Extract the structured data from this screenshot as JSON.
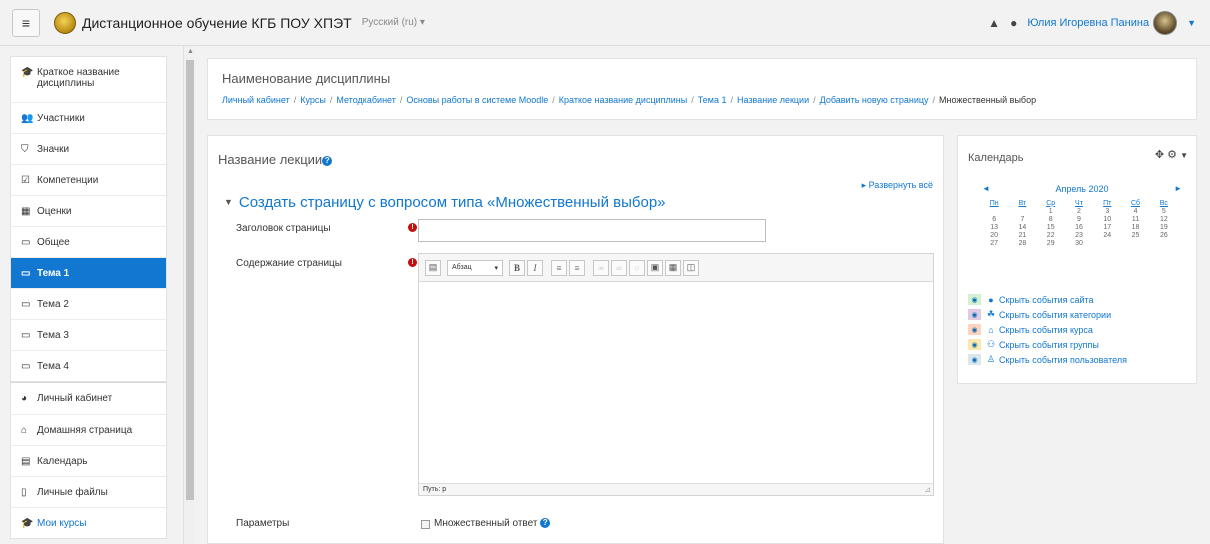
{
  "navbar": {
    "toggle_glyph": "≡",
    "site_name": "Дистанционное обучение КГБ ПОУ ХПЭТ",
    "language": "Русский (ru) ▾",
    "user_name": "Юлия Игоревна Панина"
  },
  "drawer": {
    "course_items": [
      {
        "label": "Краткое название дисциплины",
        "icon": "graduation-cap-icon",
        "glyph": "🎓"
      },
      {
        "label": "Участники",
        "icon": "users-icon",
        "glyph": "👥"
      },
      {
        "label": "Значки",
        "icon": "shield-icon",
        "glyph": "⛉"
      },
      {
        "label": "Компетенции",
        "icon": "checkbox-icon",
        "glyph": "☑"
      },
      {
        "label": "Оценки",
        "icon": "table-icon",
        "glyph": "▦"
      },
      {
        "label": "Общее",
        "icon": "folder-icon",
        "glyph": "▭"
      },
      {
        "label": "Тема 1",
        "icon": "folder-icon",
        "glyph": "▭"
      },
      {
        "label": "Тема 2",
        "icon": "folder-icon",
        "glyph": "▭"
      },
      {
        "label": "Тема 3",
        "icon": "folder-icon",
        "glyph": "▭"
      },
      {
        "label": "Тема 4",
        "icon": "folder-icon",
        "glyph": "▭"
      }
    ],
    "site_items": [
      {
        "label": "Личный кабинет",
        "icon": "dashboard-icon",
        "glyph": "◕"
      },
      {
        "label": "Домашняя страница",
        "icon": "home-icon",
        "glyph": "⌂"
      },
      {
        "label": "Календарь",
        "icon": "calendar-icon",
        "glyph": "▤"
      },
      {
        "label": "Личные файлы",
        "icon": "file-icon",
        "glyph": "▯"
      },
      {
        "label": "Мои курсы",
        "icon": "graduation-cap-icon",
        "glyph": "🎓"
      }
    ]
  },
  "header": {
    "course_title": "Наименование дисциплины",
    "breadcrumb": [
      "Личный кабинет",
      "Курсы",
      "Методкабинет",
      "Основы работы в системе Moodle",
      "Краткое название дисциплины",
      "Тема 1",
      "Название лекции",
      "Добавить новую страницу",
      "Множественный выбор"
    ]
  },
  "main": {
    "lecture_title": "Название лекции",
    "expand_all": "▸ Развернуть всё",
    "section_title": "Создать страницу с вопросом типа «Множественный выбор»",
    "page_title_label": "Заголовок страницы",
    "page_title_value": "",
    "page_content_label": "Содержание страницы",
    "editor_format": "Абзац",
    "editor_path": "Путь: p",
    "params_label": "Параметры",
    "multiple_answer_label": "Множественный ответ"
  },
  "calendar": {
    "title": "Календарь",
    "month": "Апрель 2020",
    "prev": "◄",
    "next": "►",
    "weekdays": [
      "Пн",
      "Вт",
      "Ср",
      "Чт",
      "Пт",
      "Сб",
      "Вс"
    ],
    "weeks": [
      [
        "",
        "",
        "1",
        "2",
        "3",
        "4",
        "5"
      ],
      [
        "6",
        "7",
        "8",
        "9",
        "10",
        "11",
        "12"
      ],
      [
        "13",
        "14",
        "15",
        "16",
        "17",
        "18",
        "19"
      ],
      [
        "20",
        "21",
        "22",
        "23",
        "24",
        "25",
        "26"
      ],
      [
        "27",
        "28",
        "29",
        "30",
        "",
        "",
        ""
      ]
    ],
    "event_filters": [
      {
        "label": "Скрыть события сайта",
        "color": "#d3f0d3",
        "icon_color": "#1177d1"
      },
      {
        "label": "Скрыть события категории",
        "color": "#e0cbe0",
        "icon_color": "#1177d1"
      },
      {
        "label": "Скрыть события курса",
        "color": "#ffd3bd",
        "icon_color": "#1177d1"
      },
      {
        "label": "Скрыть события группы",
        "color": "#fee7ae",
        "icon_color": "#1177d1"
      },
      {
        "label": "Скрыть события пользователя",
        "color": "#dce7ec",
        "icon_color": "#1177d1"
      }
    ]
  },
  "colors": {
    "accent": "#1177d1",
    "required": "#c10f0f"
  }
}
